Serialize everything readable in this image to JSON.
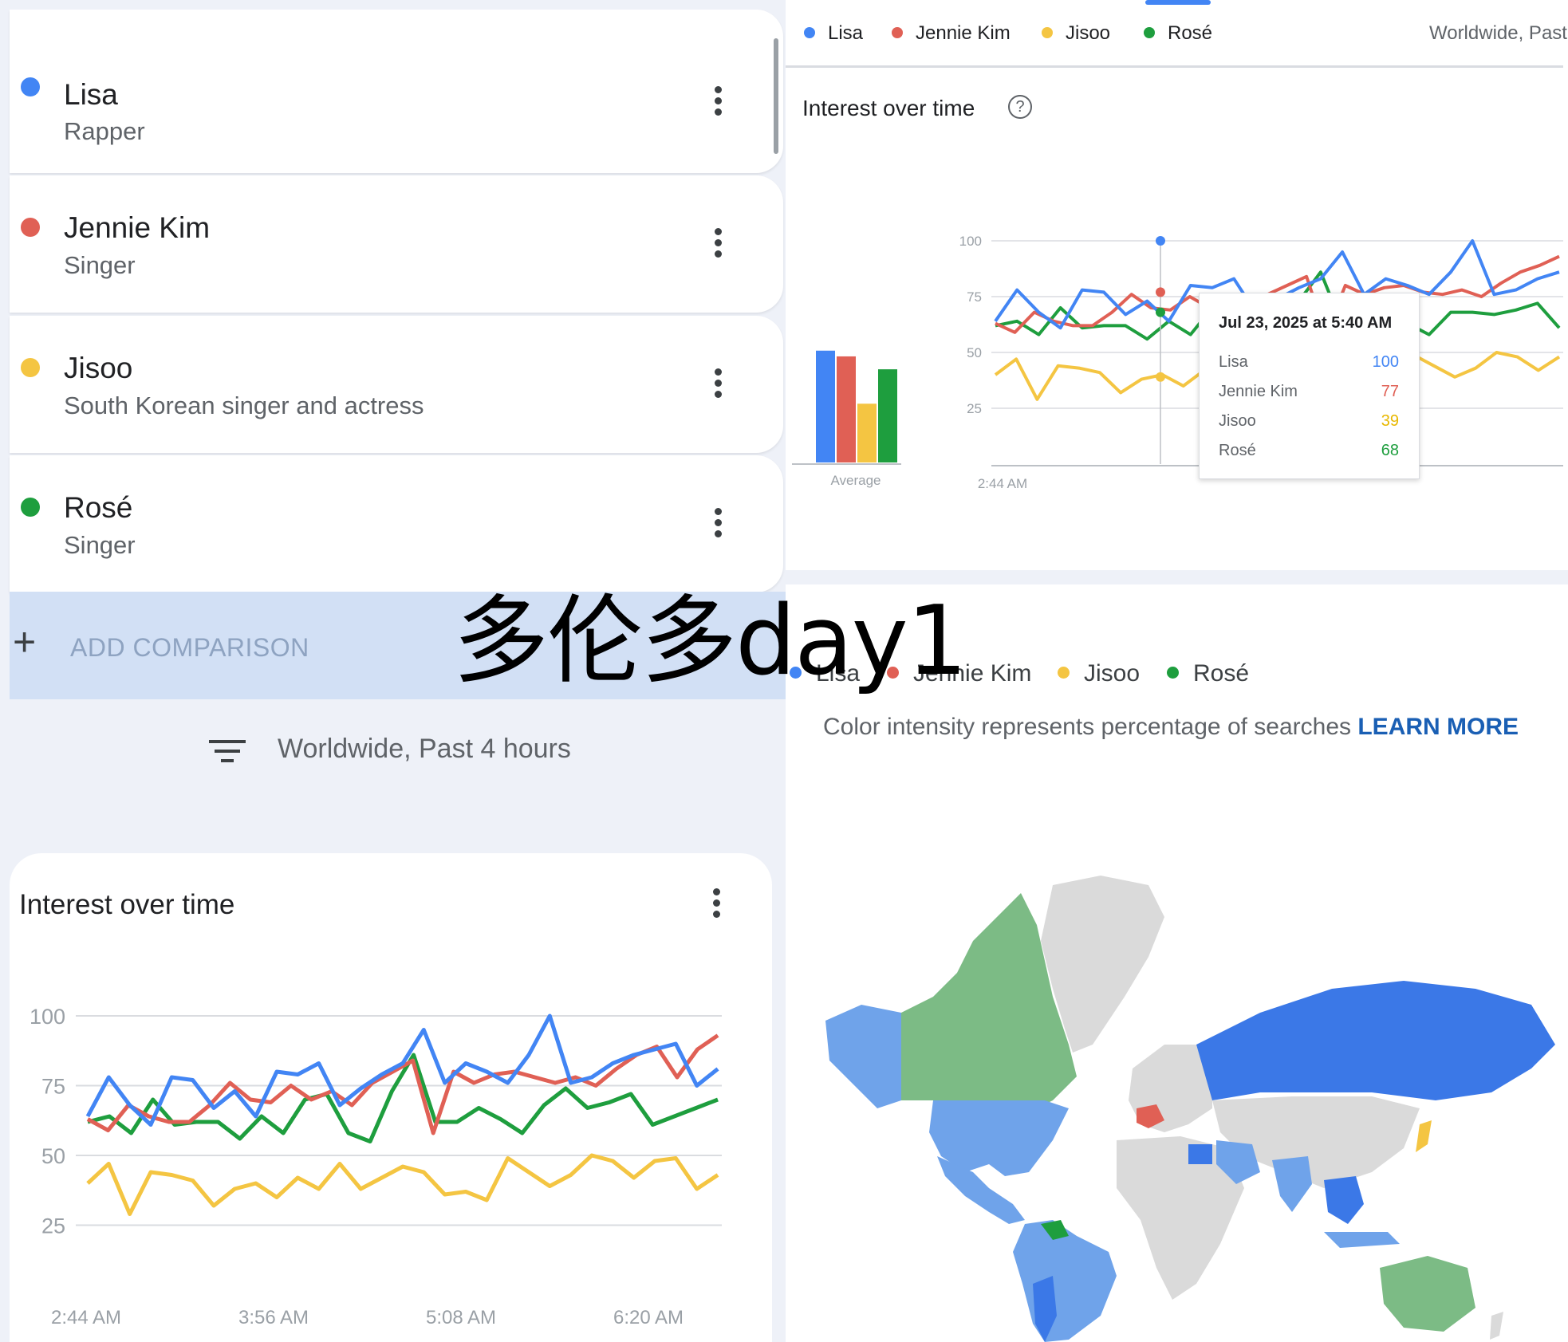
{
  "colors": {
    "lisa": "#4285f4",
    "jennie": "#e06055",
    "jisoo": "#f4c542",
    "rose": "#1e9e3e",
    "gray": "#dadada",
    "grid": "#dadce0"
  },
  "terms": [
    {
      "name": "Lisa",
      "subtitle": "Rapper"
    },
    {
      "name": "Jennie Kim",
      "subtitle": "Singer"
    },
    {
      "name": "Jisoo",
      "subtitle": "South Korean singer and actress"
    },
    {
      "name": "Rosé",
      "subtitle": "Singer"
    }
  ],
  "add_comparison": {
    "icon": "plus-icon",
    "label": "ADD COMPARISON"
  },
  "filter": {
    "icon": "filter-icon",
    "label": "Worldwide, Past 4 hours"
  },
  "left_chart": {
    "title": "Interest over time",
    "menu_icon": "more-vert-icon"
  },
  "overlay_text": "多伦多day1",
  "right_header": {
    "region_label": "Worldwide, Past"
  },
  "right_chart": {
    "title": "Interest over time",
    "help_icon": "help-circle-icon",
    "average_label": "Average",
    "first_tick": "2:44 AM",
    "last_tick_partial": "5:40 AM"
  },
  "tooltip": {
    "title": "Jul 23, 2025 at 5:40 AM",
    "rows": [
      {
        "label": "Lisa",
        "value": "100"
      },
      {
        "label": "Jennie Kim",
        "value": "77"
      },
      {
        "label": "Jisoo",
        "value": "39"
      },
      {
        "label": "Rosé",
        "value": "68"
      }
    ]
  },
  "map_section": {
    "legend": [
      "Lisa",
      "Jennie Kim",
      "Jisoo",
      "Rosé"
    ],
    "intensity_text": "Color intensity represents percentage of searches ",
    "learn_more": "LEARN MORE"
  },
  "chart_data": [
    {
      "type": "line",
      "title": "Interest over time",
      "x": [
        "2:44 AM",
        "3:56 AM",
        "5:08 AM",
        "6:20 AM"
      ],
      "ylim": [
        0,
        100
      ],
      "yticks": [
        25,
        50,
        75,
        100
      ],
      "series": [
        {
          "name": "Lisa",
          "values": [
            64,
            78,
            68,
            61,
            78,
            77,
            67,
            73,
            64,
            80,
            79,
            83,
            68,
            74,
            79,
            83,
            95,
            76,
            83,
            80,
            76,
            86,
            100,
            76,
            78,
            83,
            86,
            88,
            90,
            75,
            81
          ]
        },
        {
          "name": "Jennie Kim",
          "values": [
            63,
            59,
            68,
            64,
            62,
            62,
            68,
            76,
            70,
            69,
            75,
            70,
            73,
            68,
            76,
            80,
            84,
            58,
            80,
            76,
            79,
            80,
            78,
            76,
            78,
            75,
            81,
            86,
            89,
            78,
            88,
            93
          ]
        },
        {
          "name": "Jisoo",
          "values": [
            40,
            47,
            29,
            44,
            43,
            41,
            32,
            38,
            40,
            35,
            42,
            38,
            47,
            38,
            42,
            46,
            44,
            36,
            37,
            34,
            49,
            44,
            39,
            43,
            50,
            48,
            42,
            48,
            49,
            38,
            43
          ]
        },
        {
          "name": "Rosé",
          "values": [
            62,
            64,
            58,
            70,
            61,
            62,
            62,
            56,
            64,
            58,
            70,
            72,
            58,
            55,
            73,
            86,
            62,
            62,
            67,
            63,
            58,
            68,
            74,
            67,
            69,
            72,
            61,
            64,
            67,
            70
          ]
        }
      ]
    },
    {
      "type": "bar",
      "title": "Interest over time",
      "categories": [
        "Lisa",
        "Jennie Kim",
        "Jisoo",
        "Rosé"
      ],
      "values": [
        78,
        74,
        41,
        65
      ],
      "xlabel": "Average",
      "ylim": [
        0,
        100
      ]
    },
    {
      "type": "line",
      "title": "Interest over time",
      "x": [
        "2:44 AM",
        "5:40 AM"
      ],
      "ylim": [
        0,
        100
      ],
      "yticks": [
        25,
        50,
        75,
        100
      ],
      "series": [
        {
          "name": "Lisa",
          "values": [
            64,
            78,
            68,
            61,
            78,
            77,
            67,
            73,
            64,
            80,
            79,
            83,
            68,
            74,
            79,
            83,
            95,
            76,
            83,
            80,
            76,
            86,
            100,
            76,
            78,
            83,
            86
          ]
        },
        {
          "name": "Jennie Kim",
          "values": [
            63,
            59,
            68,
            64,
            62,
            62,
            68,
            76,
            70,
            69,
            75,
            70,
            73,
            68,
            76,
            80,
            84,
            58,
            80,
            76,
            79,
            80,
            77,
            76,
            78,
            75,
            81,
            86,
            89,
            93
          ]
        },
        {
          "name": "Jisoo",
          "values": [
            40,
            47,
            29,
            44,
            43,
            41,
            32,
            38,
            40,
            35,
            42,
            38,
            47,
            38,
            42,
            46,
            44,
            36,
            37,
            34,
            49,
            44,
            39,
            43,
            50,
            48,
            42,
            48
          ]
        },
        {
          "name": "Rosé",
          "values": [
            62,
            64,
            58,
            70,
            61,
            62,
            62,
            56,
            64,
            58,
            70,
            72,
            58,
            55,
            73,
            86,
            62,
            62,
            67,
            63,
            58,
            68,
            68,
            67,
            69,
            72,
            61
          ]
        }
      ]
    }
  ]
}
